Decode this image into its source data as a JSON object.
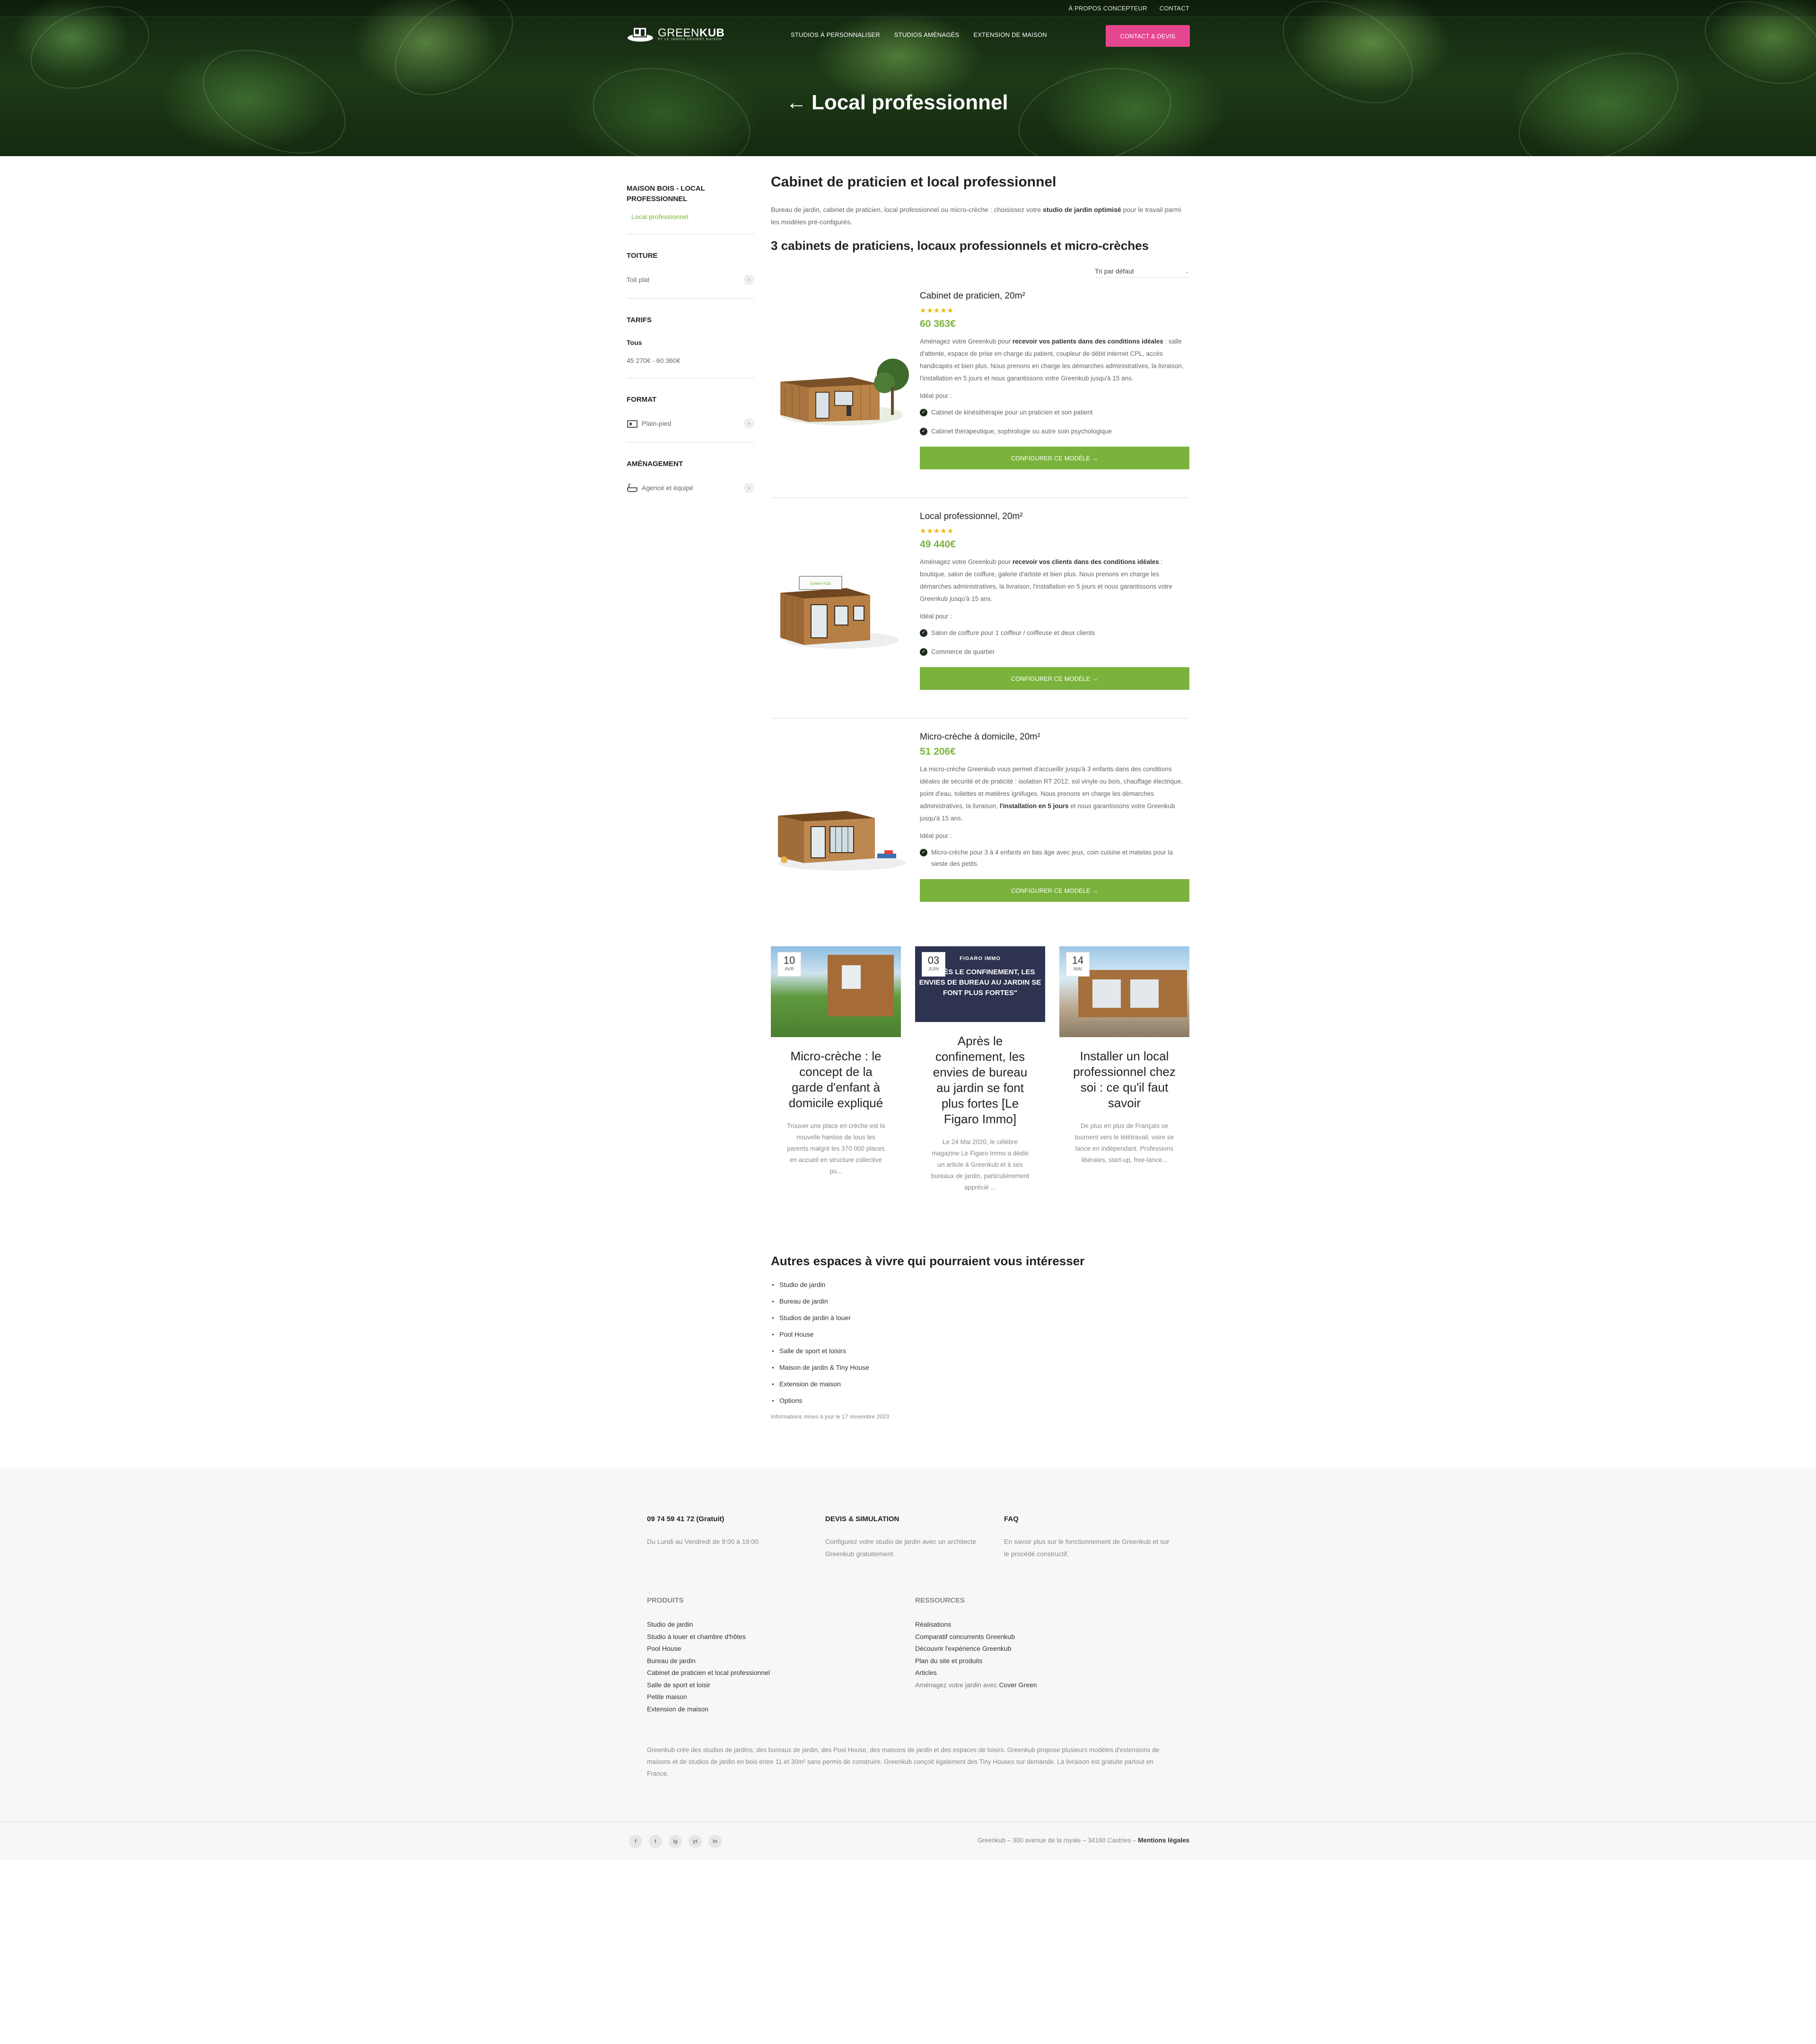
{
  "header": {
    "topbar_links": [
      "À PROPOS CONCEPTEUR",
      "CONTACT"
    ],
    "logo_text_light": "GREEN",
    "logo_text_bold": "KUB",
    "logo_subtitle": "ET LE JARDIN DEVIENT MAISON",
    "nav": [
      "STUDIOS À PERSONNALISER",
      "STUDIOS AMÉNAGÉS",
      "EXTENSION DE MAISON"
    ],
    "cta": "CONTACT & DEVIS",
    "page_title": "Local professionnel",
    "back_arrow": "←"
  },
  "sidebar": {
    "category_title": "MAISON BOIS - LOCAL PROFESSIONNEL",
    "category_link": "Local professionnel",
    "toiture": {
      "title": "TOITURE",
      "item": "Toit plat"
    },
    "tarifs": {
      "title": "TARIFS",
      "all": "Tous",
      "range": "45 270€ - 60 360€"
    },
    "format": {
      "title": "FORMAT",
      "item": "Plain-pied"
    },
    "amenagement": {
      "title": "AMÉNAGEMENT",
      "item": "Agencé et équipé"
    },
    "chevron": "›"
  },
  "main": {
    "title": "Cabinet de praticien et local professionnel",
    "intro_pre": "Bureau de jardin, cabinet de praticien, local professionnel ou micro-crèche : choisissez votre ",
    "intro_bold": "studio de jardin optimisé",
    "intro_post": " pour le travail parmi les modèles pré-configurés.",
    "subtitle": "3 cabinets de praticiens, locaux professionnels et micro-crèches",
    "sort_label": "Tri par défaut",
    "ideal_label": "Idéal pour :",
    "config_label": "CONFIGURER CE MODÈLE →"
  },
  "products": [
    {
      "name": "Cabinet de praticien, 20m²",
      "stars": "★★★★★",
      "price": "60 363€",
      "desc_pre": "Aménagez votre Greenkub pour ",
      "desc_bold": "recevoir vos patients dans des conditions idéales",
      "desc_post": " : salle d'attente, espace de prise en charge du patient, coupleur de débit internet CPL, accès handicapés et bien plus. Nous prenons en charge les démarches administratives, la livraison, l'installation en 5 jours et nous garantissons votre Greenkub jusqu'à 15 ans.",
      "uses": [
        "Cabinet de kinésithérapie pour un praticien et son patient",
        "Cabinet thérapeutique, sophrologie ou autre soin psychologique"
      ]
    },
    {
      "name": "Local professionnel, 20m²",
      "stars": "★★★★★",
      "price": "49 440€",
      "desc_pre": "Aménagez votre Greenkub pour ",
      "desc_bold": "recevoir vos clients dans des conditions idéales",
      "desc_post": " : boutique, salon de coiffure, galerie d'artiste et bien plus. Nous prenons en charge les démarches administratives, la livraison, l'installation en 5 jours et nous garantissons votre Greenkub jusqu'à 15 ans.",
      "uses": [
        "Salon de coiffure pour 1 coiffeur / coiffeuse et deux clients",
        "Commerce de quartier"
      ]
    },
    {
      "name": "Micro-crèche à domicile, 20m²",
      "stars": "",
      "price": "51 206€",
      "desc_pre": "La micro-crèche Greenkub vous permet d'accueillir jusqu'à 3 enfants dans des conditions idéales de sécurité et de praticité : isolation RT 2012, sol vinyle ou bois, chauffage électrique, point d'eau, toilettes et matières ignifuges. Nous prenons en charge les démarches administratives, la livraison, ",
      "desc_bold": "l'installation en 5 jours",
      "desc_post": " et nous garantissons votre Greenkub jusqu'à 15 ans.",
      "uses": [
        "Micro-crèche pour 3 à 4 enfants en bas âge avec jeux, coin cuisine et matelas pour la sieste des petits."
      ]
    }
  ],
  "blog": [
    {
      "day": "10",
      "month": "AVR",
      "title": "Micro-crèche : le concept de la garde d'enfant à domicile expliqué",
      "excerpt": "Trouver une place en crèche est la nouvelle hantise de tous les parents malgré les 370 000 places en accueil en structure collective po..."
    },
    {
      "day": "03",
      "month": "JUIN",
      "overlay": "\"APRÈS LE CONFINEMENT, LES ENVIES DE BUREAU AU JARDIN SE FONT PLUS FORTES\"",
      "brand": "FIGARO IMMO",
      "title": "Après le confinement, les envies de bureau au jardin se font plus fortes [Le Figaro Immo]",
      "excerpt": "Le 24 Mai 2020, le célèbre magazine Le Figaro Immo a dédié un article à Greenkub et à ses bureaux de jardin, particulièrement apprécié ..."
    },
    {
      "day": "14",
      "month": "MAI",
      "title": "Installer un local professionnel chez soi : ce qu'il faut savoir",
      "excerpt": "De plus en plus de Français se tournent vers le télétravail, voire se lance en indépendant. Professions libérales, start-up, free-lance..."
    }
  ],
  "other_spaces": {
    "title": "Autres espaces à vivre qui pourraient vous intéresser",
    "items": [
      "Studio de jardin",
      "Bureau de jardin",
      "Studios de jardin à louer",
      "Pool House",
      "Salle de sport et loisirs",
      "Maison de jardin & Tiny House",
      "Extension de maison",
      "Options"
    ],
    "updated": "Informations mises à jour le 17 novembre 2023"
  },
  "footer": {
    "phone_title": "09 74 59 41 72 (Gratuit)",
    "phone_desc": "Du Lundi au Vendredi de 9:00 à 19:00",
    "devis_title": "DEVIS & SIMULATION",
    "devis_desc": "Configurez votre studio de jardin avec un architecte Greenkub gratuitement.",
    "faq_title": "FAQ",
    "faq_desc": "En savoir plus sur le fonctionnement de Greenkub et sur le procédé constructif.",
    "produits_title": "PRODUITS",
    "produits": [
      "Studio de jardin",
      "Studio à louer et chambre d'hôtes",
      "Pool House",
      "Bureau de jardin",
      "Cabinet de praticien et local professionnel",
      "Salle de sport et loisir",
      "Petite maison",
      "Extension de maison"
    ],
    "ressources_title": "RESSOURCES",
    "ressources": [
      "Réalisations",
      "Comparatif concurrents Greenkub",
      "Découvrir l'expérience Greenkub",
      "Plan du site et produits",
      "Articles"
    ],
    "ressources_last_pre": "Aménagez votre jardin avec ",
    "ressources_last_link": "Cover Green",
    "about": "Greenkub crée des studios de jardins, des bureaux de jardin, des Pool House, des maisons de jardin et des espaces de loisirs. Greenkub propose plusieurs modèles d'extensions de maisons et de studios de jardin en bois entre 11 et 30m² sans permis de construire. Greenkub conçoit également des Tiny Houses sur demande. La livraison est gratuite partout en France.",
    "socials": [
      "f",
      "t",
      "ig",
      "yt",
      "in"
    ],
    "address": "Greenkub – 300 avenue de la royale – 34160 Castries – ",
    "legal": "Mentions légales"
  }
}
